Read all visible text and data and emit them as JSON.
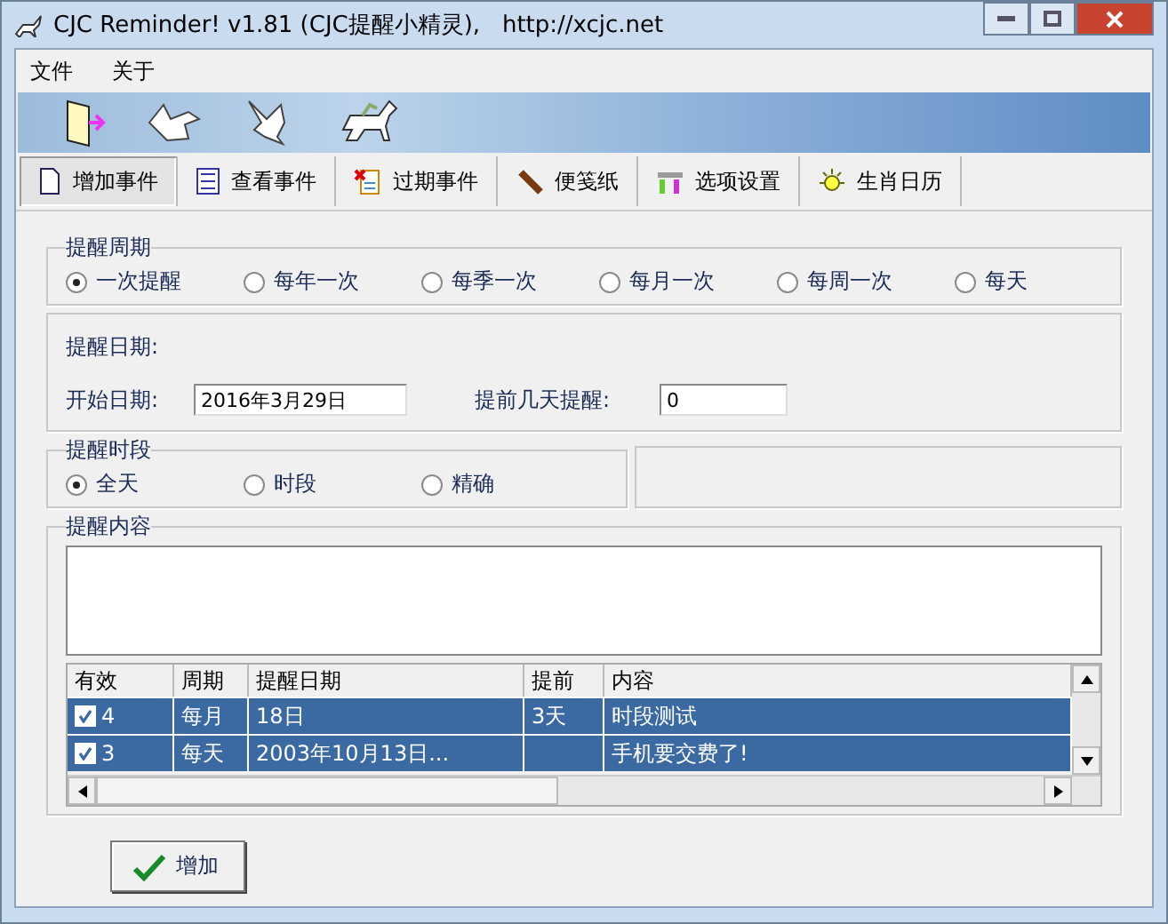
{
  "window": {
    "title": "CJC Reminder! v1.81 (CJC提醒小精灵),   http://xcjc.net"
  },
  "menu": [
    "文件",
    "关于"
  ],
  "tabs": [
    {
      "label": "增加事件",
      "selected": true
    },
    {
      "label": "查看事件",
      "selected": false
    },
    {
      "label": "过期事件",
      "selected": false
    },
    {
      "label": "便笺纸",
      "selected": false
    },
    {
      "label": "选项设置",
      "selected": false
    },
    {
      "label": "生肖日历",
      "selected": false
    }
  ],
  "cycle": {
    "title": "提醒周期",
    "options": [
      {
        "label": "一次提醒",
        "selected": true
      },
      {
        "label": "每年一次",
        "selected": false
      },
      {
        "label": "每季一次",
        "selected": false
      },
      {
        "label": "每月一次",
        "selected": false
      },
      {
        "label": "每周一次",
        "selected": false
      },
      {
        "label": "每天",
        "selected": false
      }
    ]
  },
  "date": {
    "title": "提醒日期:",
    "start_label": "开始日期:",
    "start_value": "2016年3月29日",
    "advance_label": "提前几天提醒:",
    "advance_value": "0"
  },
  "period": {
    "title": "提醒时段",
    "options": [
      {
        "label": "全天",
        "selected": true
      },
      {
        "label": "时段",
        "selected": false
      },
      {
        "label": "精确",
        "selected": false
      }
    ]
  },
  "content": {
    "title": "提醒内容"
  },
  "table": {
    "columns": [
      "有效",
      "周期",
      "提醒日期",
      "提前",
      "内容"
    ],
    "rows": [
      {
        "checked": true,
        "selected": true,
        "cells": [
          "4",
          "每月",
          "18日",
          "3天",
          "时段测试"
        ]
      },
      {
        "checked": true,
        "selected": true,
        "cells": [
          "3",
          "每天",
          "2003年10月13日...",
          "",
          "手机要交费了!"
        ]
      }
    ]
  },
  "add_button": "增加"
}
